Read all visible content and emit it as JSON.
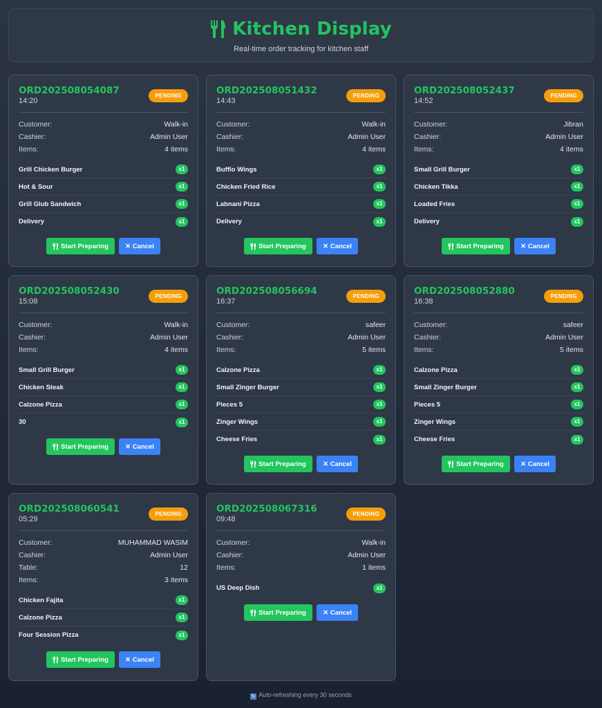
{
  "header": {
    "title": "Kitchen Display",
    "subtitle": "Real-time order tracking for kitchen staff",
    "icon": "utensils-icon"
  },
  "labels": {
    "customer": "Customer:",
    "cashier": "Cashier:",
    "table": "Table:",
    "items": "Items:",
    "start": "Start Preparing",
    "cancel": "✕ Cancel"
  },
  "colors": {
    "accent": "#22c55e",
    "pending": "#f59e0b",
    "cancel": "#3b82f6"
  },
  "orders": [
    {
      "id": "ORD202508054087",
      "time": "14:20",
      "status": "PENDING",
      "customer": "Walk-in",
      "cashier": "Admin User",
      "item_count": "4 items",
      "items": [
        {
          "name": "Grill Chicken Burger",
          "qty": "x1"
        },
        {
          "name": "Hot & Sour",
          "qty": "x1"
        },
        {
          "name": "Grill Glub Sandwich",
          "qty": "x1"
        },
        {
          "name": "Delivery",
          "qty": "x1"
        }
      ]
    },
    {
      "id": "ORD202508051432",
      "time": "14:43",
      "status": "PENDING",
      "customer": "Walk-in",
      "cashier": "Admin User",
      "item_count": "4 items",
      "items": [
        {
          "name": "Bufflo Wings",
          "qty": "x1"
        },
        {
          "name": "Chicken Fried Rice",
          "qty": "x1"
        },
        {
          "name": "Labnani Pizza",
          "qty": "x1"
        },
        {
          "name": "Delivery",
          "qty": "x1"
        }
      ]
    },
    {
      "id": "ORD202508052437",
      "time": "14:52",
      "status": "PENDING",
      "customer": "Jibran",
      "cashier": "Admin User",
      "item_count": "4 items",
      "items": [
        {
          "name": "Small Grill Burger",
          "qty": "x1"
        },
        {
          "name": "Chicken Tikka",
          "qty": "x1"
        },
        {
          "name": "Loaded Fries",
          "qty": "x1"
        },
        {
          "name": "Delivery",
          "qty": "x1"
        }
      ]
    },
    {
      "id": "ORD202508052430",
      "time": "15:08",
      "status": "PENDING",
      "customer": "Walk-in",
      "cashier": "Admin User",
      "item_count": "4 items",
      "items": [
        {
          "name": "Small Grill Burger",
          "qty": "x1"
        },
        {
          "name": "Chicken Steak",
          "qty": "x1"
        },
        {
          "name": "Calzone Pizza",
          "qty": "x1"
        },
        {
          "name": "30",
          "qty": "x1"
        }
      ]
    },
    {
      "id": "ORD202508056694",
      "time": "16:37",
      "status": "PENDING",
      "customer": "safeer",
      "cashier": "Admin User",
      "item_count": "5 items",
      "items": [
        {
          "name": "Calzone Pizza",
          "qty": "x1"
        },
        {
          "name": "Small Zinger Burger",
          "qty": "x1"
        },
        {
          "name": "Pieces 5",
          "qty": "x1"
        },
        {
          "name": "Zinger Wings",
          "qty": "x1"
        },
        {
          "name": "Cheese Fries",
          "qty": "x1"
        }
      ]
    },
    {
      "id": "ORD202508052880",
      "time": "16:38",
      "status": "PENDING",
      "customer": "safeer",
      "cashier": "Admin User",
      "item_count": "5 items",
      "items": [
        {
          "name": "Calzone Pizza",
          "qty": "x1"
        },
        {
          "name": "Small Zinger Burger",
          "qty": "x1"
        },
        {
          "name": "Pieces 5",
          "qty": "x1"
        },
        {
          "name": "Zinger Wings",
          "qty": "x1"
        },
        {
          "name": "Cheese Fries",
          "qty": "x1"
        }
      ]
    },
    {
      "id": "ORD202508060541",
      "time": "05:29",
      "status": "PENDING",
      "customer": "MUHAMMAD WASIM",
      "cashier": "Admin User",
      "table": "12",
      "item_count": "3 items",
      "items": [
        {
          "name": "Chicken Fajita",
          "qty": "x1"
        },
        {
          "name": "Calzone Pizza",
          "qty": "x1"
        },
        {
          "name": "Four Session Pizza",
          "qty": "x1"
        }
      ]
    },
    {
      "id": "ORD202508067316",
      "time": "09:48",
      "status": "PENDING",
      "customer": "Walk-in",
      "cashier": "Admin User",
      "item_count": "1 items",
      "items": [
        {
          "name": "US Deep Dish",
          "qty": "x1"
        }
      ]
    }
  ],
  "footer": {
    "text": "Auto-refreshing every 30 seconds",
    "icon": "refresh-icon"
  }
}
